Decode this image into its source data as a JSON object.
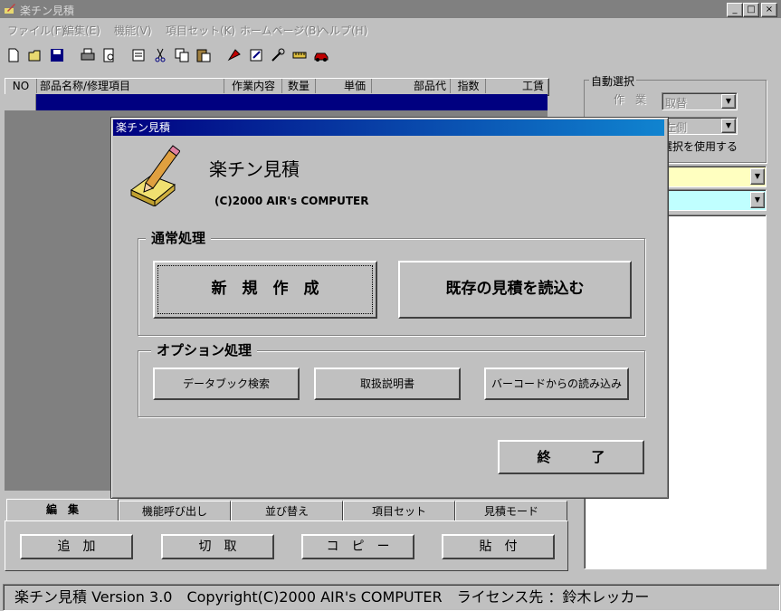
{
  "window": {
    "title": "楽チン見積",
    "min_label": "_",
    "max_label": "□",
    "close_label": "×"
  },
  "menu": {
    "items": [
      "ファイル(F)",
      "編集(E)",
      "機能(V)",
      "項目セット(K)",
      "ホームページ(B)",
      "ヘルプ(H)"
    ]
  },
  "table": {
    "columns": [
      "NO",
      "部品名称/修理項目",
      "作業内容",
      "数量",
      "単価",
      "部品代",
      "指数",
      "工賃"
    ]
  },
  "auto_select": {
    "legend": "自動選択",
    "work_label": "作　業",
    "work_value": "取替",
    "side_value": "左側",
    "checkbox_text": "選択を使用する"
  },
  "dialog": {
    "title": "楽チン見積",
    "app_name": "楽チン見積",
    "copyright": "(C)2000 AIR's COMPUTER",
    "normal_group": "通常処理",
    "new_button": "新　規　作　成",
    "open_button": "既存の見積を読込む",
    "option_group": "オプション処理",
    "databook_button": "データブック検索",
    "manual_button": "取扱説明書",
    "barcode_button": "バーコードからの読み込み",
    "exit_button": "終　　　了"
  },
  "tabs": {
    "items": [
      "編　集",
      "機能呼び出し",
      "並び替え",
      "項目セット",
      "見積モード"
    ],
    "buttons": [
      "追　加",
      "切　取",
      "コ　ピ　ー",
      "貼　付"
    ]
  },
  "status": {
    "text": "楽チン見積 Version 3.0　Copyright(C)2000 AIR's COMPUTER　ライセンス先 ：鈴木レッカー"
  }
}
